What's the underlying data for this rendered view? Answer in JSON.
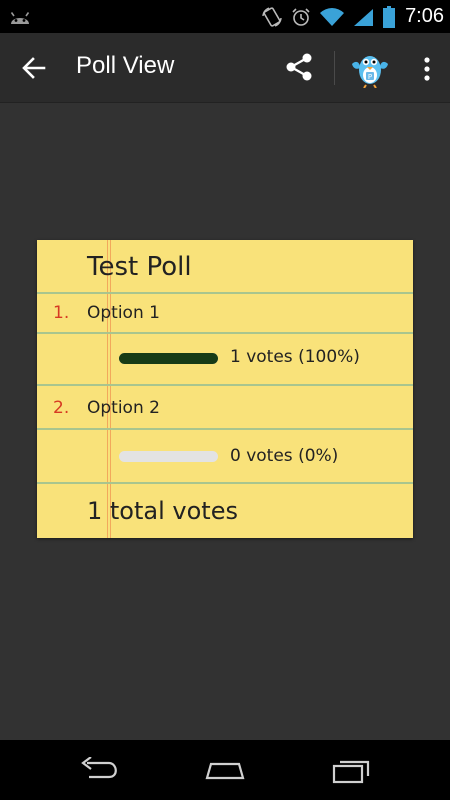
{
  "status_bar": {
    "time": "7:06",
    "icons": [
      "android-icon",
      "rotation-lock-icon",
      "alarm-icon",
      "wifi-icon",
      "cell-signal-icon",
      "battery-icon"
    ]
  },
  "action_bar": {
    "title": "Poll View",
    "back_icon": "arrow-left-icon",
    "share_icon": "share-icon",
    "app_icon": "bird-app-icon",
    "overflow_icon": "overflow-menu-icon"
  },
  "poll": {
    "title": "Test Poll",
    "options": [
      {
        "number": "1.",
        "label": "Option 1",
        "votes_text": "1 votes (100%)",
        "fraction": 1.0,
        "bar_color": "#173b16"
      },
      {
        "number": "2.",
        "label": "Option 2",
        "votes_text": "0 votes (0%)",
        "fraction": 0.0,
        "bar_color": "#e3e3e3"
      }
    ],
    "total": "1 total votes"
  },
  "colors": {
    "paper": "#f9e27a",
    "rule_line": "#a9c58e",
    "margin_line": "#f2a85c",
    "number_red": "#d63a23",
    "filled_bar": "#173b16",
    "empty_bar": "#e3e3e3"
  },
  "nav_bar": {
    "icons": [
      "back-nav-icon",
      "home-nav-icon",
      "recents-nav-icon"
    ]
  }
}
